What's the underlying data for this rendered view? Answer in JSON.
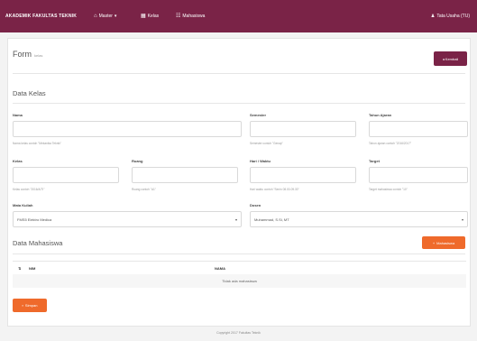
{
  "navbar": {
    "brand": "AKADEMIK FAKULTAS TEKNIK",
    "menu1": "Master",
    "menu2": "Kelas",
    "menu3": "Mahasiswa",
    "user": "Tata Usaha (TU)"
  },
  "page": {
    "title": "Form",
    "subtitle": "kelas",
    "back_label": "Kembali"
  },
  "section_kelas": "Data Kelas",
  "fields": {
    "nama": {
      "label": "Nama",
      "value": "",
      "hint": "Nama kelas contoh \"Mekanika Teknik\""
    },
    "semester": {
      "label": "Semester",
      "value": "",
      "hint": "Semester contoh \"Genap\""
    },
    "tahun_ajaran": {
      "label": "Tahun Ajaran",
      "value": "",
      "hint": "Tahun ajaran contoh \"2016/2017\""
    },
    "kelas": {
      "label": "Kelas",
      "value": "",
      "hint": "Kelas contoh \"2016/A/TI\""
    },
    "ruang": {
      "label": "Ruang",
      "value": "",
      "hint": "Ruang contoh \"A1\""
    },
    "hari_waktu": {
      "label": "Hari / Waktu",
      "value": "",
      "hint": "Hari waktu contoh \"Senin 08.00-09.30\""
    },
    "target": {
      "label": "Target",
      "value": "",
      "hint": "Target mahasiswa contoh \"10\""
    },
    "mata_kuliah": {
      "label": "Mata Kuliah",
      "value": "FMS5 Elektro Medica"
    },
    "dosen": {
      "label": "Dosen",
      "value": "Muhammad, S.Si, MT"
    }
  },
  "section_mahasiswa": "Data Mahasiswa",
  "add_mahasiswa_label": "Mahasiswa",
  "table": {
    "col_nim": "NIM",
    "col_nama": "NAMA",
    "empty": "Tidak ada mahasiswa"
  },
  "save_label": "Simpan",
  "footer": "Copyright 2017 Fakultas Teknik"
}
